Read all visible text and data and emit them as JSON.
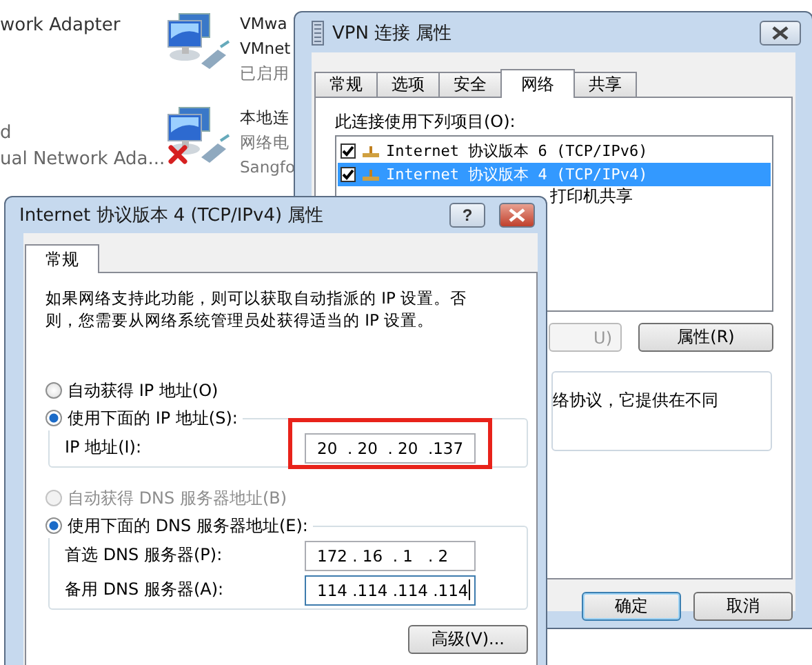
{
  "explorer": {
    "left_adapters": [
      {
        "lines": [
          "work Adapter"
        ]
      },
      {
        "lines": [
          "d",
          "ual Network Ada..."
        ]
      }
    ],
    "adapters": [
      {
        "disconnected": false,
        "lines": [
          {
            "text": "VMwa",
            "muted": false
          },
          {
            "text": "VMnet",
            "muted": false
          },
          {
            "text": "已启用",
            "muted": true
          }
        ]
      },
      {
        "disconnected": true,
        "lines": [
          {
            "text": "本地连",
            "muted": false
          },
          {
            "text": "网络电",
            "muted": true
          },
          {
            "text": "Sangfo",
            "muted": true
          }
        ]
      }
    ]
  },
  "vpn_dialog": {
    "title": "VPN 连接 属性",
    "tabs": [
      {
        "label": "常规",
        "selected": false
      },
      {
        "label": "选项",
        "selected": false
      },
      {
        "label": "安全",
        "selected": false
      },
      {
        "label": "网络",
        "selected": true
      },
      {
        "label": "共享",
        "selected": false
      }
    ],
    "items_label": "此连接使用下列项目(O):",
    "items": [
      {
        "label": "Internet 协议版本 6 (TCP/IPv6)",
        "checked": true,
        "selected": false
      },
      {
        "label": "Internet 协议版本 4 (TCP/IPv4)",
        "checked": true,
        "selected": true
      }
    ],
    "item_partial": "打印机共享",
    "install_button_partial": {
      "label": "U)",
      "disabled": true
    },
    "properties_button": "属性(R)",
    "description_partial": "络协议，它提供在不同",
    "buttons": [
      "确定",
      "取消"
    ]
  },
  "ipv4_dialog": {
    "title": "Internet 协议版本 4 (TCP/IPv4) 属性",
    "help_button": "?",
    "tabs": [
      {
        "label": "常规",
        "selected": true
      }
    ],
    "description": "如果网络支持此功能，则可以获取自动指派的 IP 设置。否则，您需要从网络系统管理员处获得适当的 IP 设置。",
    "ip_mode": [
      {
        "label": "自动获得 IP 地址(O)",
        "selected": false,
        "disabled": false
      },
      {
        "label": "使用下面的 IP 地址(S):",
        "selected": true,
        "disabled": false
      }
    ],
    "ip_fields": [
      {
        "label": "IP 地址(I):",
        "value": "20  . 20  . 20  .137",
        "highlighted": true,
        "focused": false
      }
    ],
    "dns_mode": [
      {
        "label": "自动获得 DNS 服务器地址(B)",
        "selected": false,
        "disabled": true
      },
      {
        "label": "使用下面的 DNS 服务器地址(E):",
        "selected": true,
        "disabled": false
      }
    ],
    "dns_fields": [
      {
        "label": "首选 DNS 服务器(P):",
        "value": "172 . 16  . 1   . 2",
        "highlighted": false,
        "focused": false
      },
      {
        "label": "备用 DNS 服务器(A):",
        "value": "114 .114 .114 .114",
        "highlighted": false,
        "focused": true
      }
    ],
    "advanced_button": "高级(V)..."
  }
}
